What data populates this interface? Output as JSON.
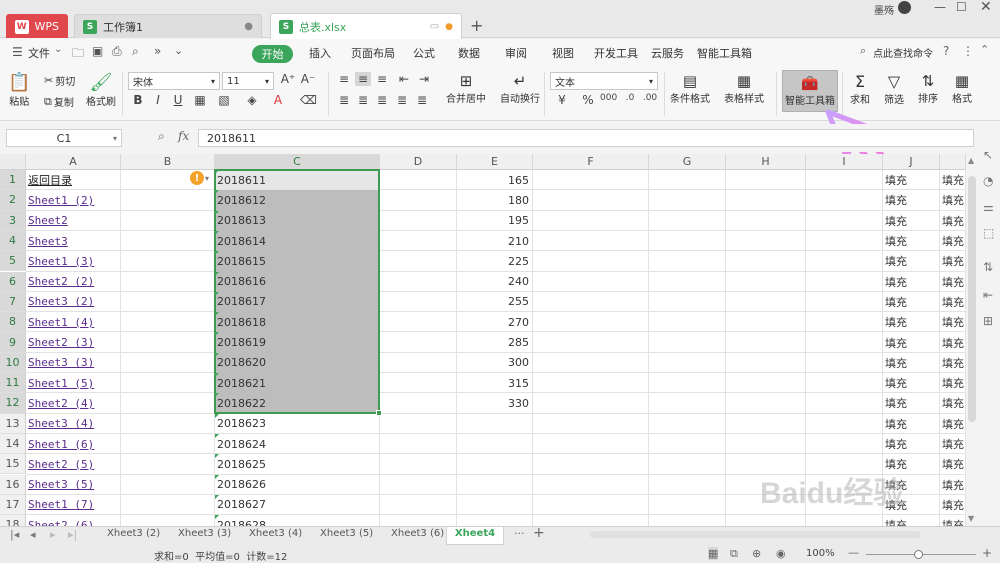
{
  "window": {
    "tabs": [
      {
        "label": "WPS",
        "type": "app"
      },
      {
        "label": "工作簿1",
        "type": "sheet"
      },
      {
        "label": "总表.xlsx",
        "type": "sheet",
        "active": true
      }
    ],
    "user": "墨殇",
    "colors": {
      "green": "#3aa55b",
      "wps_red": "#e0474d",
      "selection_border": "#3d9a50",
      "link": "#5a2d8c"
    }
  },
  "menu": {
    "file": "文件",
    "items": [
      "开始",
      "插入",
      "页面布局",
      "公式",
      "数据",
      "审阅",
      "视图",
      "开发工具",
      "云服务",
      "智能工具箱"
    ],
    "search": "点此查找命令"
  },
  "ribbon": {
    "paste": "粘贴",
    "cut": "剪切",
    "copy": "复制",
    "format_painter": "格式刷",
    "font_name": "宋体",
    "font_size": "11",
    "merge": "合并居中",
    "wrap": "自动换行",
    "number_format": "文本",
    "cond_format": "条件格式",
    "table_style": "表格样式",
    "smart_toolbox": "智能工具箱",
    "sum": "求和",
    "filter": "筛选",
    "sort": "排序",
    "format": "格式"
  },
  "formula_bar": {
    "name_box": "C1",
    "fx": "fx",
    "value": "2018611"
  },
  "grid": {
    "columns": [
      "A",
      "B",
      "C",
      "D",
      "E",
      "F",
      "G",
      "H",
      "I",
      "J"
    ],
    "rows": [
      "1",
      "2",
      "3",
      "4",
      "5",
      "6",
      "7",
      "8",
      "9",
      "10",
      "11",
      "12",
      "13",
      "14",
      "15",
      "16",
      "17",
      "18"
    ],
    "col_a": [
      "返回目录",
      "Sheet1 (2)",
      "Sheet2",
      "Sheet3",
      "Sheet1 (3)",
      "Sheet2 (2)",
      "Sheet3 (2)",
      "Sheet1 (4)",
      "Sheet2 (3)",
      "Sheet3 (3)",
      "Sheet1 (5)",
      "Sheet2 (4)",
      "Sheet3 (4)",
      "Sheet1 (6)",
      "Sheet2 (5)",
      "Sheet3 (5)",
      "Sheet1 (7)",
      "Sheet2 (6)"
    ],
    "col_c": [
      "2018611",
      "2018612",
      "2018613",
      "2018614",
      "2018615",
      "2018616",
      "2018617",
      "2018618",
      "2018619",
      "2018620",
      "2018621",
      "2018622",
      "2018623",
      "2018624",
      "2018625",
      "2018626",
      "2018627",
      "2018628"
    ],
    "col_e": [
      "165",
      "180",
      "195",
      "210",
      "225",
      "240",
      "255",
      "270",
      "285",
      "300",
      "315",
      "330"
    ],
    "col_j": "填充",
    "col_k": "填充"
  },
  "sheets": [
    "Xheet3 (2)",
    "Xheet3 (3)",
    "Xheet3 (4)",
    "Xheet3 (5)",
    "Xheet3 (6)",
    "Xheet4"
  ],
  "status": {
    "text": "求和=0  平均值=0  计数=12",
    "zoom": "100%"
  },
  "watermark": "Baidu经验 jingyan.baidu.com"
}
